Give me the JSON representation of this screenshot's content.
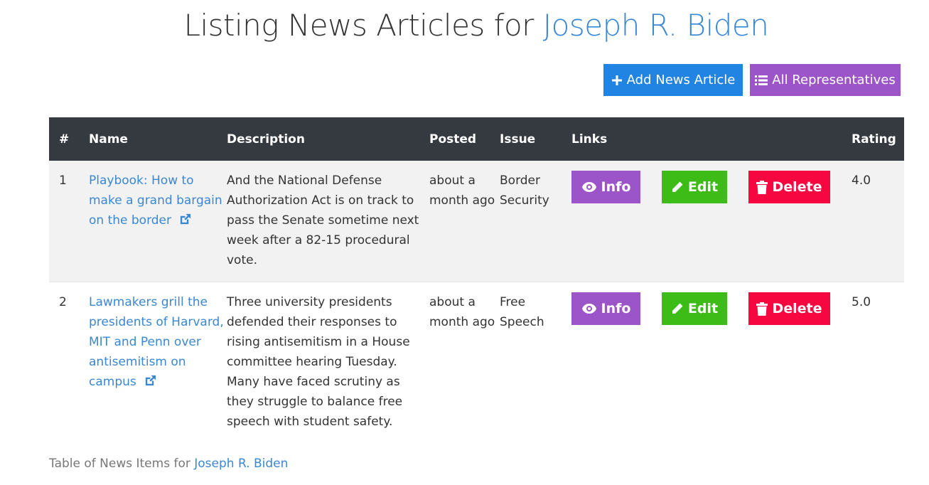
{
  "header": {
    "title_prefix": "Listing News Articles for",
    "representative": "Joseph R. Biden"
  },
  "toolbar": {
    "add_label": "Add News Article",
    "all_label": "All Representatives"
  },
  "table": {
    "columns": [
      "#",
      "Name",
      "Description",
      "Posted",
      "Issue",
      "Links",
      "Rating"
    ],
    "rows": [
      {
        "num": "1",
        "name": "Playbook: How to make a grand bargain on the border",
        "description": "And the National Defense Authorization Act is on track to pass the Senate sometime next week after a 82-15 procedural vote.",
        "posted": "about a month ago",
        "issue": "Border Security",
        "rating": "4.0"
      },
      {
        "num": "2",
        "name": "Lawmakers grill the presidents of Harvard, MIT and Penn over antisemitism on campus",
        "description": "Three university presidents defended their responses to rising antisemitism in a House committee hearing Tuesday. Many have faced scrutiny as they struggle to balance free speech with student safety.",
        "posted": "about a month ago",
        "issue": "Free Speech",
        "rating": "5.0"
      }
    ],
    "actions": {
      "info": "Info",
      "edit": "Edit",
      "delete": "Delete"
    }
  },
  "footer": {
    "prefix": "Table of News Items for",
    "representative": "Joseph R. Biden"
  },
  "icons": {
    "add": "plus-icon",
    "all": "list-icon",
    "external": "external-link-icon",
    "info": "eye-icon",
    "edit": "pencil-icon",
    "delete": "trash-icon"
  },
  "colors": {
    "primary": "#2183e2",
    "purple": "#9b55c9",
    "green": "#3dbb17",
    "red": "#f7073f",
    "header_dark": "#343a40",
    "link": "#3a87d3"
  }
}
